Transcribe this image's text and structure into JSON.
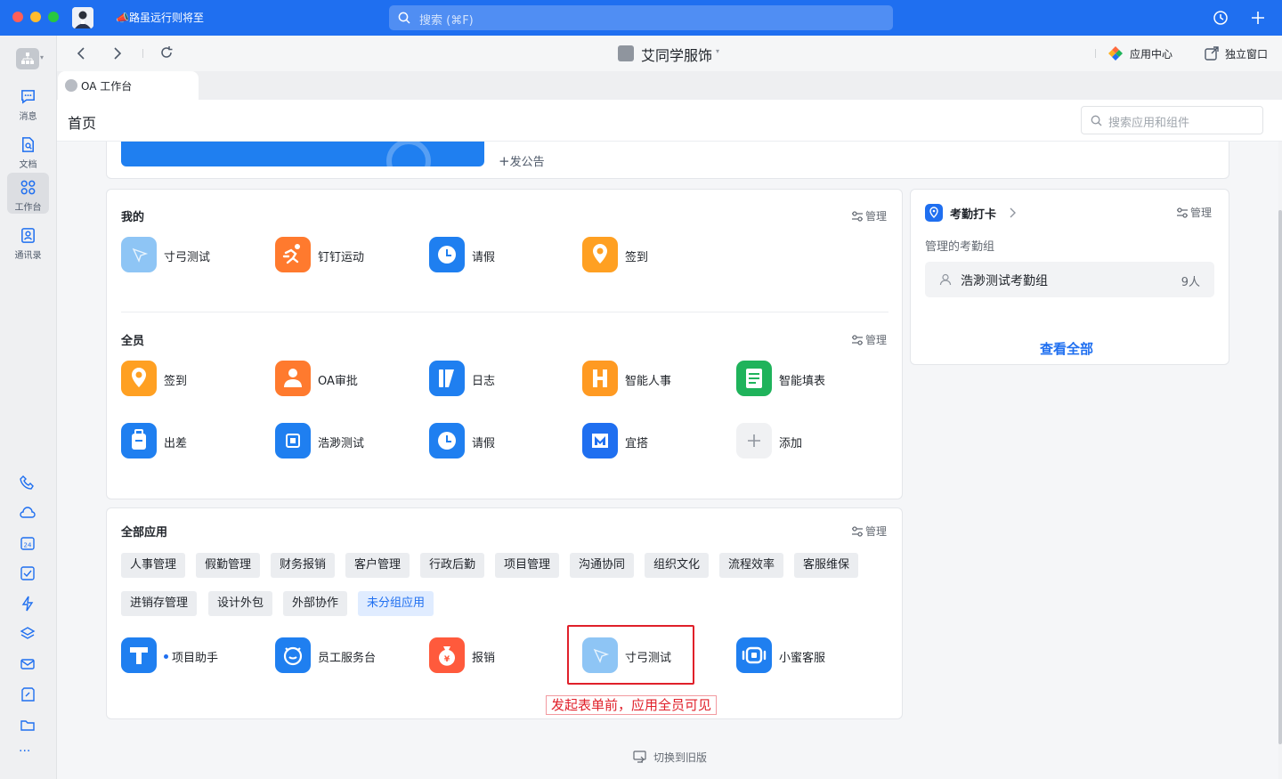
{
  "titlebar": {
    "status": "路虽远行则将至",
    "search_placeholder": "搜索 (⌘F)"
  },
  "sidebar": {
    "items": [
      {
        "label": "消息",
        "icon": "message-icon"
      },
      {
        "label": "文档",
        "icon": "document-icon"
      },
      {
        "label": "工作台",
        "icon": "workbench-icon"
      },
      {
        "label": "通讯录",
        "icon": "contacts-icon"
      }
    ]
  },
  "toolbar": {
    "org_name": "艾同学服饰",
    "app_center": "应用中心",
    "standalone_window": "独立窗口"
  },
  "tab": {
    "label": "OA 工作台"
  },
  "header": {
    "title": "首页",
    "search_placeholder": "搜索应用和组件"
  },
  "announcement": {
    "post_label": "发公告"
  },
  "manage_label": "管理",
  "mine": {
    "title": "我的",
    "apps": [
      {
        "name": "寸弓测试",
        "icon": "cun-gong-test-icon",
        "color": "#8ec5f5"
      },
      {
        "name": "钉钉运动",
        "icon": "dingtalk-sport-icon",
        "color": "#ff7a2e"
      },
      {
        "name": "请假",
        "icon": "leave-icon",
        "color": "#1f7ff0"
      },
      {
        "name": "签到",
        "icon": "checkin-icon",
        "color": "#ffa022"
      }
    ]
  },
  "all_staff": {
    "title": "全员",
    "apps": [
      {
        "name": "签到",
        "icon": "checkin-icon",
        "color": "#ffa022"
      },
      {
        "name": "OA审批",
        "icon": "oa-approval-icon",
        "color": "#ff7a2e"
      },
      {
        "name": "日志",
        "icon": "log-icon",
        "color": "#1f7ff0"
      },
      {
        "name": "智能人事",
        "icon": "smart-hr-icon",
        "color": "#ff9a22"
      },
      {
        "name": "智能填表",
        "icon": "smart-form-icon",
        "color": "#1fb35b"
      },
      {
        "name": "出差",
        "icon": "business-trip-icon",
        "color": "#1f7ff0"
      },
      {
        "name": "浩渺测试",
        "icon": "haomiao-test-icon",
        "color": "#1f7ff0"
      },
      {
        "name": "请假",
        "icon": "leave-icon",
        "color": "#1f7ff0"
      },
      {
        "name": "宜搭",
        "icon": "yida-icon",
        "color": "#1f6ff0"
      },
      {
        "name": "添加",
        "icon": "add-icon",
        "color": "#f0f1f3"
      }
    ]
  },
  "attendance": {
    "title": "考勤打卡",
    "subtitle": "管理的考勤组",
    "group_name": "浩渺测试考勤组",
    "group_count": "9人",
    "view_all": "查看全部"
  },
  "all_apps": {
    "title": "全部应用",
    "categories": [
      "人事管理",
      "假勤管理",
      "财务报销",
      "客户管理",
      "行政后勤",
      "项目管理",
      "沟通协同",
      "组织文化",
      "流程效率",
      "客服维保",
      "进销存管理",
      "设计外包",
      "外部协作",
      "未分组应用"
    ],
    "selected_category": "未分组应用",
    "apps": [
      {
        "name": "项目助手",
        "icon": "project-assistant-icon",
        "color": "#1f7ff0"
      },
      {
        "name": "员工服务台",
        "icon": "employee-service-icon",
        "color": "#1f7ff0"
      },
      {
        "name": "报销",
        "icon": "reimburse-icon",
        "color": "#ff5a3c"
      },
      {
        "name": "寸弓测试",
        "icon": "cun-gong-test-icon",
        "color": "#8ec5f5"
      },
      {
        "name": "小蜜客服",
        "icon": "xiaomi-service-icon",
        "color": "#1f7ff0"
      }
    ]
  },
  "annotation": "发起表单前，应用全员可见",
  "footer": {
    "switch_old": "切换到旧版"
  }
}
